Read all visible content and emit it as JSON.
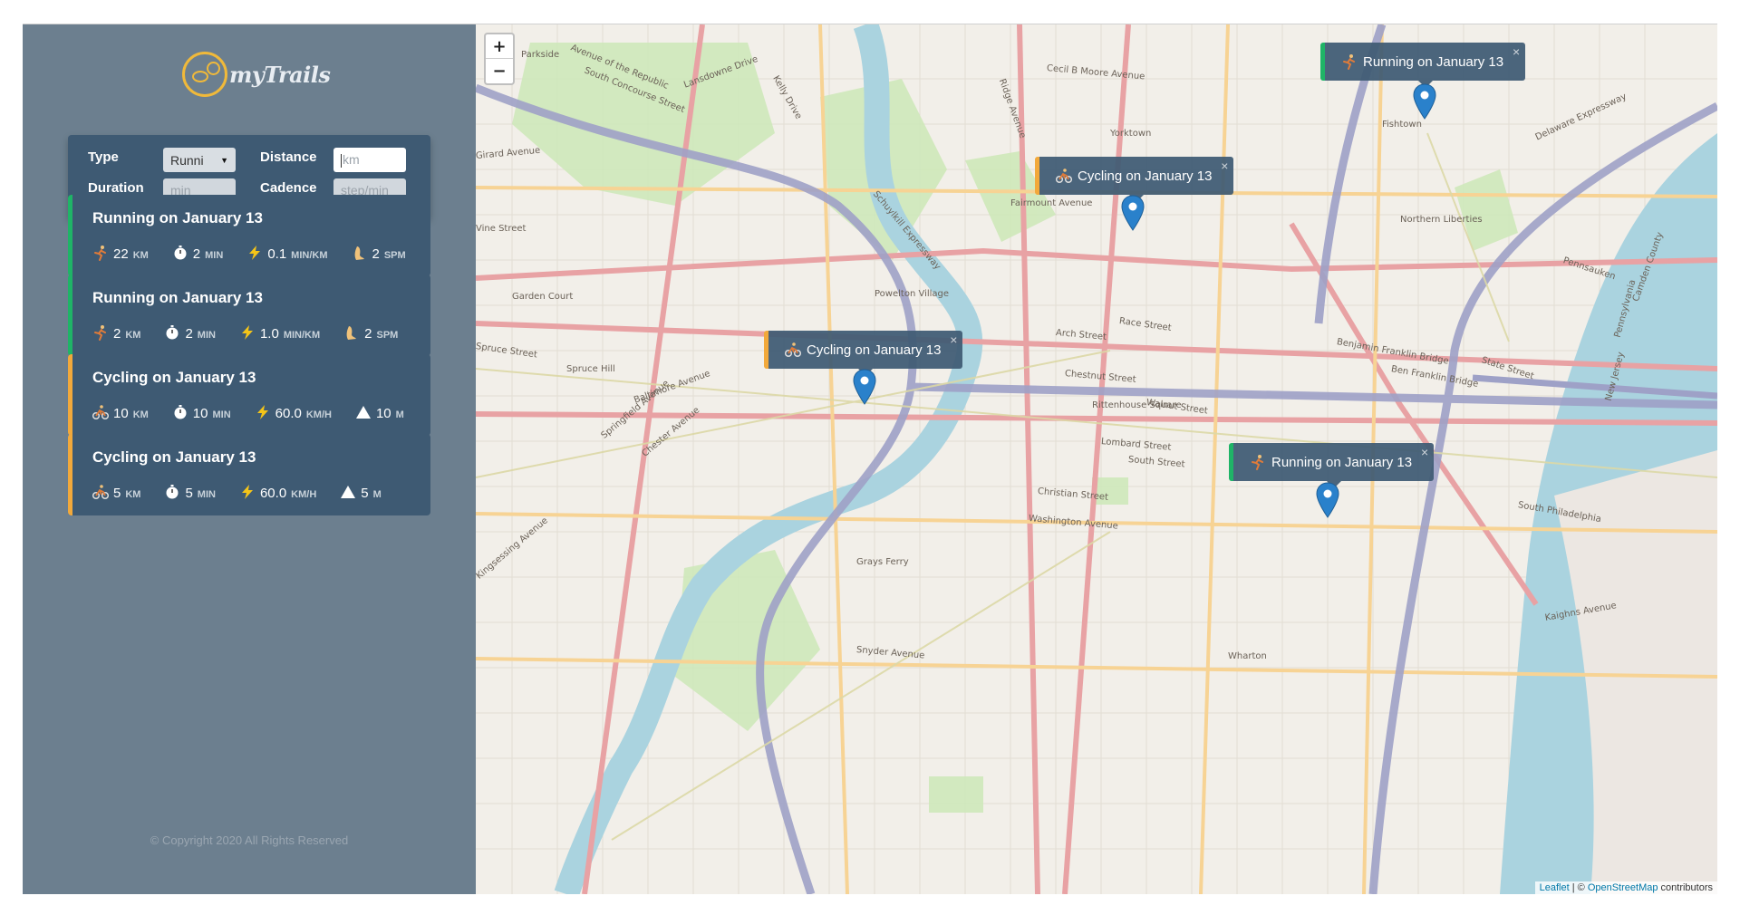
{
  "brand": {
    "name": "myTrails"
  },
  "form": {
    "type_label": "Type",
    "type_value": "Runni",
    "distance_label": "Distance",
    "distance_placeholder": "km",
    "duration_label": "Duration",
    "duration_placeholder": "min",
    "cadence_label": "Cadence",
    "cadence_placeholder": "step/min"
  },
  "workouts": [
    {
      "kind": "running",
      "title": "Running on January 13",
      "stats": [
        {
          "icon": "runner-icon",
          "value": "22",
          "unit": "KM"
        },
        {
          "icon": "stopwatch-icon",
          "value": "2",
          "unit": "MIN"
        },
        {
          "icon": "lightning-icon",
          "value": "0.1",
          "unit": "MIN/KM"
        },
        {
          "icon": "footprint-icon",
          "value": "2",
          "unit": "SPM"
        }
      ]
    },
    {
      "kind": "running",
      "title": "Running on January 13",
      "stats": [
        {
          "icon": "runner-icon",
          "value": "2",
          "unit": "KM"
        },
        {
          "icon": "stopwatch-icon",
          "value": "2",
          "unit": "MIN"
        },
        {
          "icon": "lightning-icon",
          "value": "1.0",
          "unit": "MIN/KM"
        },
        {
          "icon": "footprint-icon",
          "value": "2",
          "unit": "SPM"
        }
      ]
    },
    {
      "kind": "cycling",
      "title": "Cycling on January 13",
      "stats": [
        {
          "icon": "bicycle-icon",
          "value": "10",
          "unit": "KM"
        },
        {
          "icon": "stopwatch-icon",
          "value": "10",
          "unit": "MIN"
        },
        {
          "icon": "lightning-icon",
          "value": "60.0",
          "unit": "KM/H"
        },
        {
          "icon": "mountain-icon",
          "value": "10",
          "unit": "M"
        }
      ]
    },
    {
      "kind": "cycling",
      "title": "Cycling on January 13",
      "stats": [
        {
          "icon": "bicycle-icon",
          "value": "5",
          "unit": "KM"
        },
        {
          "icon": "stopwatch-icon",
          "value": "5",
          "unit": "MIN"
        },
        {
          "icon": "lightning-icon",
          "value": "60.0",
          "unit": "KM/H"
        },
        {
          "icon": "mountain-icon",
          "value": "5",
          "unit": "M"
        }
      ]
    }
  ],
  "copyright": "© Copyright 2020 All Rights Reserved",
  "map": {
    "zoom_in": "+",
    "zoom_out": "−",
    "popups": [
      {
        "kind": "running",
        "text": "Running on January 13",
        "close": "×"
      },
      {
        "kind": "cycling",
        "text": "Cycling on January 13",
        "close": "×"
      },
      {
        "kind": "cycling",
        "text": "Cycling on January 13",
        "close": "×"
      },
      {
        "kind": "running",
        "text": "Running on January 13",
        "close": "×"
      }
    ],
    "labels": [
      "Avenue of the Republic",
      "South Concourse Street",
      "Lansdowne Drive",
      "Parkside",
      "Schuylkill Expressway",
      "Kelly Drive",
      "Cecil B Moore Avenue",
      "Ridge Avenue",
      "Yorktown",
      "Fairmount Avenue",
      "Vine Street",
      "Powelton Village",
      "Spruce Street",
      "Spruce Hill",
      "Baltimore Avenue",
      "Arch Street",
      "Race Street",
      "Chestnut Street",
      "Walnut Street",
      "Rittenhouse Square",
      "Lombard Street",
      "South Street",
      "Christian Street",
      "Washington Avenue",
      "Grays Ferry",
      "Snyder Avenue",
      "Wharton",
      "Fishtown",
      "Northern Liberties",
      "Benjamin Franklin Bridge",
      "Ben Franklin Bridge",
      "State Street",
      "Pennsauken",
      "Delaware Expressway",
      "South Philadelphia",
      "Kaighns Avenue",
      "Kingsessing Avenue",
      "Girard Avenue",
      "Garden Court",
      "Springfield Avenue",
      "Chester Avenue",
      "Camden County",
      "New Jersey",
      "Pennsylvania"
    ],
    "attribution_leaflet": "Leaflet",
    "attribution_sep": " | © ",
    "attribution_osm": "OpenStreetMap",
    "attribution_tail": " contributors"
  },
  "colors": {
    "running": "#1fb467",
    "cycling": "#f2a93b",
    "card_bg": "#3e5a73",
    "sidebar_bg": "#6c7f8f",
    "marker": "#2a81cb"
  }
}
